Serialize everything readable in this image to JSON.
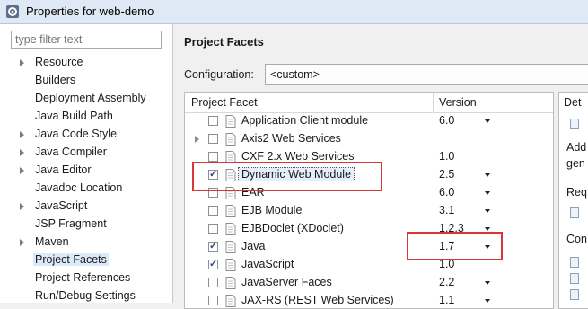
{
  "window": {
    "title": "Properties for web-demo"
  },
  "filter": {
    "placeholder": "type filter text"
  },
  "nav": [
    {
      "label": "Resource",
      "expandable": true
    },
    {
      "label": "Builders",
      "expandable": false
    },
    {
      "label": "Deployment Assembly",
      "expandable": false
    },
    {
      "label": "Java Build Path",
      "expandable": false
    },
    {
      "label": "Java Code Style",
      "expandable": true
    },
    {
      "label": "Java Compiler",
      "expandable": true
    },
    {
      "label": "Java Editor",
      "expandable": true
    },
    {
      "label": "Javadoc Location",
      "expandable": false
    },
    {
      "label": "JavaScript",
      "expandable": true
    },
    {
      "label": "JSP Fragment",
      "expandable": false
    },
    {
      "label": "Maven",
      "expandable": true
    },
    {
      "label": "Project Facets",
      "expandable": false,
      "selected": true
    },
    {
      "label": "Project References",
      "expandable": false
    },
    {
      "label": "Run/Debug Settings",
      "expandable": false
    }
  ],
  "page": {
    "heading": "Project Facets",
    "configuration_label": "Configuration:",
    "configuration_value": "<custom>"
  },
  "table": {
    "col_facet": "Project Facet",
    "col_version": "Version",
    "rows": [
      {
        "name": "Application Client module",
        "version": "6.0",
        "checked": false,
        "dropdown": true,
        "expandable": false
      },
      {
        "name": "Axis2 Web Services",
        "version": "",
        "checked": false,
        "dropdown": false,
        "expandable": true
      },
      {
        "name": "CXF 2.x Web Services",
        "version": "1.0",
        "checked": false,
        "dropdown": false,
        "expandable": false
      },
      {
        "name": "Dynamic Web Module",
        "version": "2.5",
        "checked": true,
        "dropdown": true,
        "expandable": false,
        "selected": true
      },
      {
        "name": "EAR",
        "version": "6.0",
        "checked": false,
        "dropdown": true,
        "expandable": false
      },
      {
        "name": "EJB Module",
        "version": "3.1",
        "checked": false,
        "dropdown": true,
        "expandable": false
      },
      {
        "name": "EJBDoclet (XDoclet)",
        "version": "1.2.3",
        "checked": false,
        "dropdown": true,
        "expandable": false
      },
      {
        "name": "Java",
        "version": "1.7",
        "checked": true,
        "dropdown": true,
        "expandable": false
      },
      {
        "name": "JavaScript",
        "version": "1.0",
        "checked": true,
        "dropdown": false,
        "expandable": false
      },
      {
        "name": "JavaServer Faces",
        "version": "2.2",
        "checked": false,
        "dropdown": true,
        "expandable": false
      },
      {
        "name": "JAX-RS (REST Web Services)",
        "version": "1.1",
        "checked": false,
        "dropdown": true,
        "expandable": false
      }
    ]
  },
  "side_panel": {
    "tab": "Det",
    "lines": [
      "Add",
      "gen",
      "Req",
      "Con"
    ]
  },
  "colors": {
    "highlight": "#d9363a",
    "selection": "#dbe9f8"
  }
}
